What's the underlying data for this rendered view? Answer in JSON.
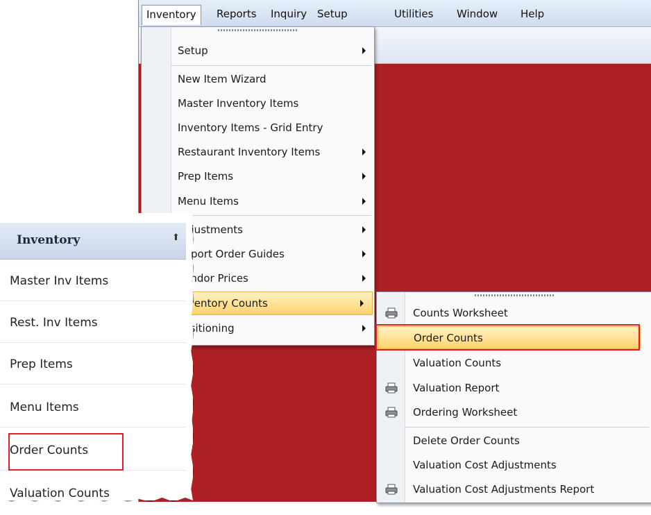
{
  "menubar": {
    "items": [
      "Inventory",
      "Reports",
      "Inquiry",
      "Setup",
      "Utilities",
      "Window",
      "Help"
    ]
  },
  "inventory_menu": {
    "items": [
      {
        "label": "Setup",
        "submenu": true
      },
      {
        "label": "New Item Wizard",
        "submenu": false
      },
      {
        "label": "Master Inventory Items",
        "submenu": false
      },
      {
        "label": "Inventory Items - Grid Entry",
        "submenu": false
      },
      {
        "label": "Restaurant Inventory Items",
        "submenu": true
      },
      {
        "label": "Prep Items",
        "submenu": true
      },
      {
        "label": "Menu Items",
        "submenu": true
      },
      {
        "label": "Adjustments",
        "submenu": true
      },
      {
        "label": "Import Order Guides",
        "submenu": true
      },
      {
        "label": "Vendor Prices",
        "submenu": true
      },
      {
        "label": "Inventory Counts",
        "submenu": true,
        "highlighted": true
      },
      {
        "label": "Positioning",
        "submenu": true
      }
    ]
  },
  "counts_menu": {
    "items": [
      {
        "label": "Counts Worksheet",
        "icon": "printer-icon"
      },
      {
        "label": "Order Counts",
        "highlighted": true
      },
      {
        "label": "Valuation Counts"
      },
      {
        "label": "Valuation Report",
        "icon": "printer-icon"
      },
      {
        "label": "Ordering Worksheet",
        "icon": "printer-icon"
      },
      {
        "label": "Delete Order Counts"
      },
      {
        "label": "Valuation Cost Adjustments"
      },
      {
        "label": "Valuation Cost Adjustments Report",
        "icon": "printer-icon"
      }
    ]
  },
  "side_panel": {
    "title": "Inventory",
    "collapse_icon": "double-chevron-up-icon",
    "items": [
      "Master Inv Items",
      "Rest. Inv Items",
      "Prep Items",
      "Menu Items",
      "Order Counts",
      "Valuation Counts"
    ]
  },
  "colors": {
    "workspace": "#ad2023",
    "highlight": "#ffd36b",
    "callout_border": "#e01f26"
  }
}
